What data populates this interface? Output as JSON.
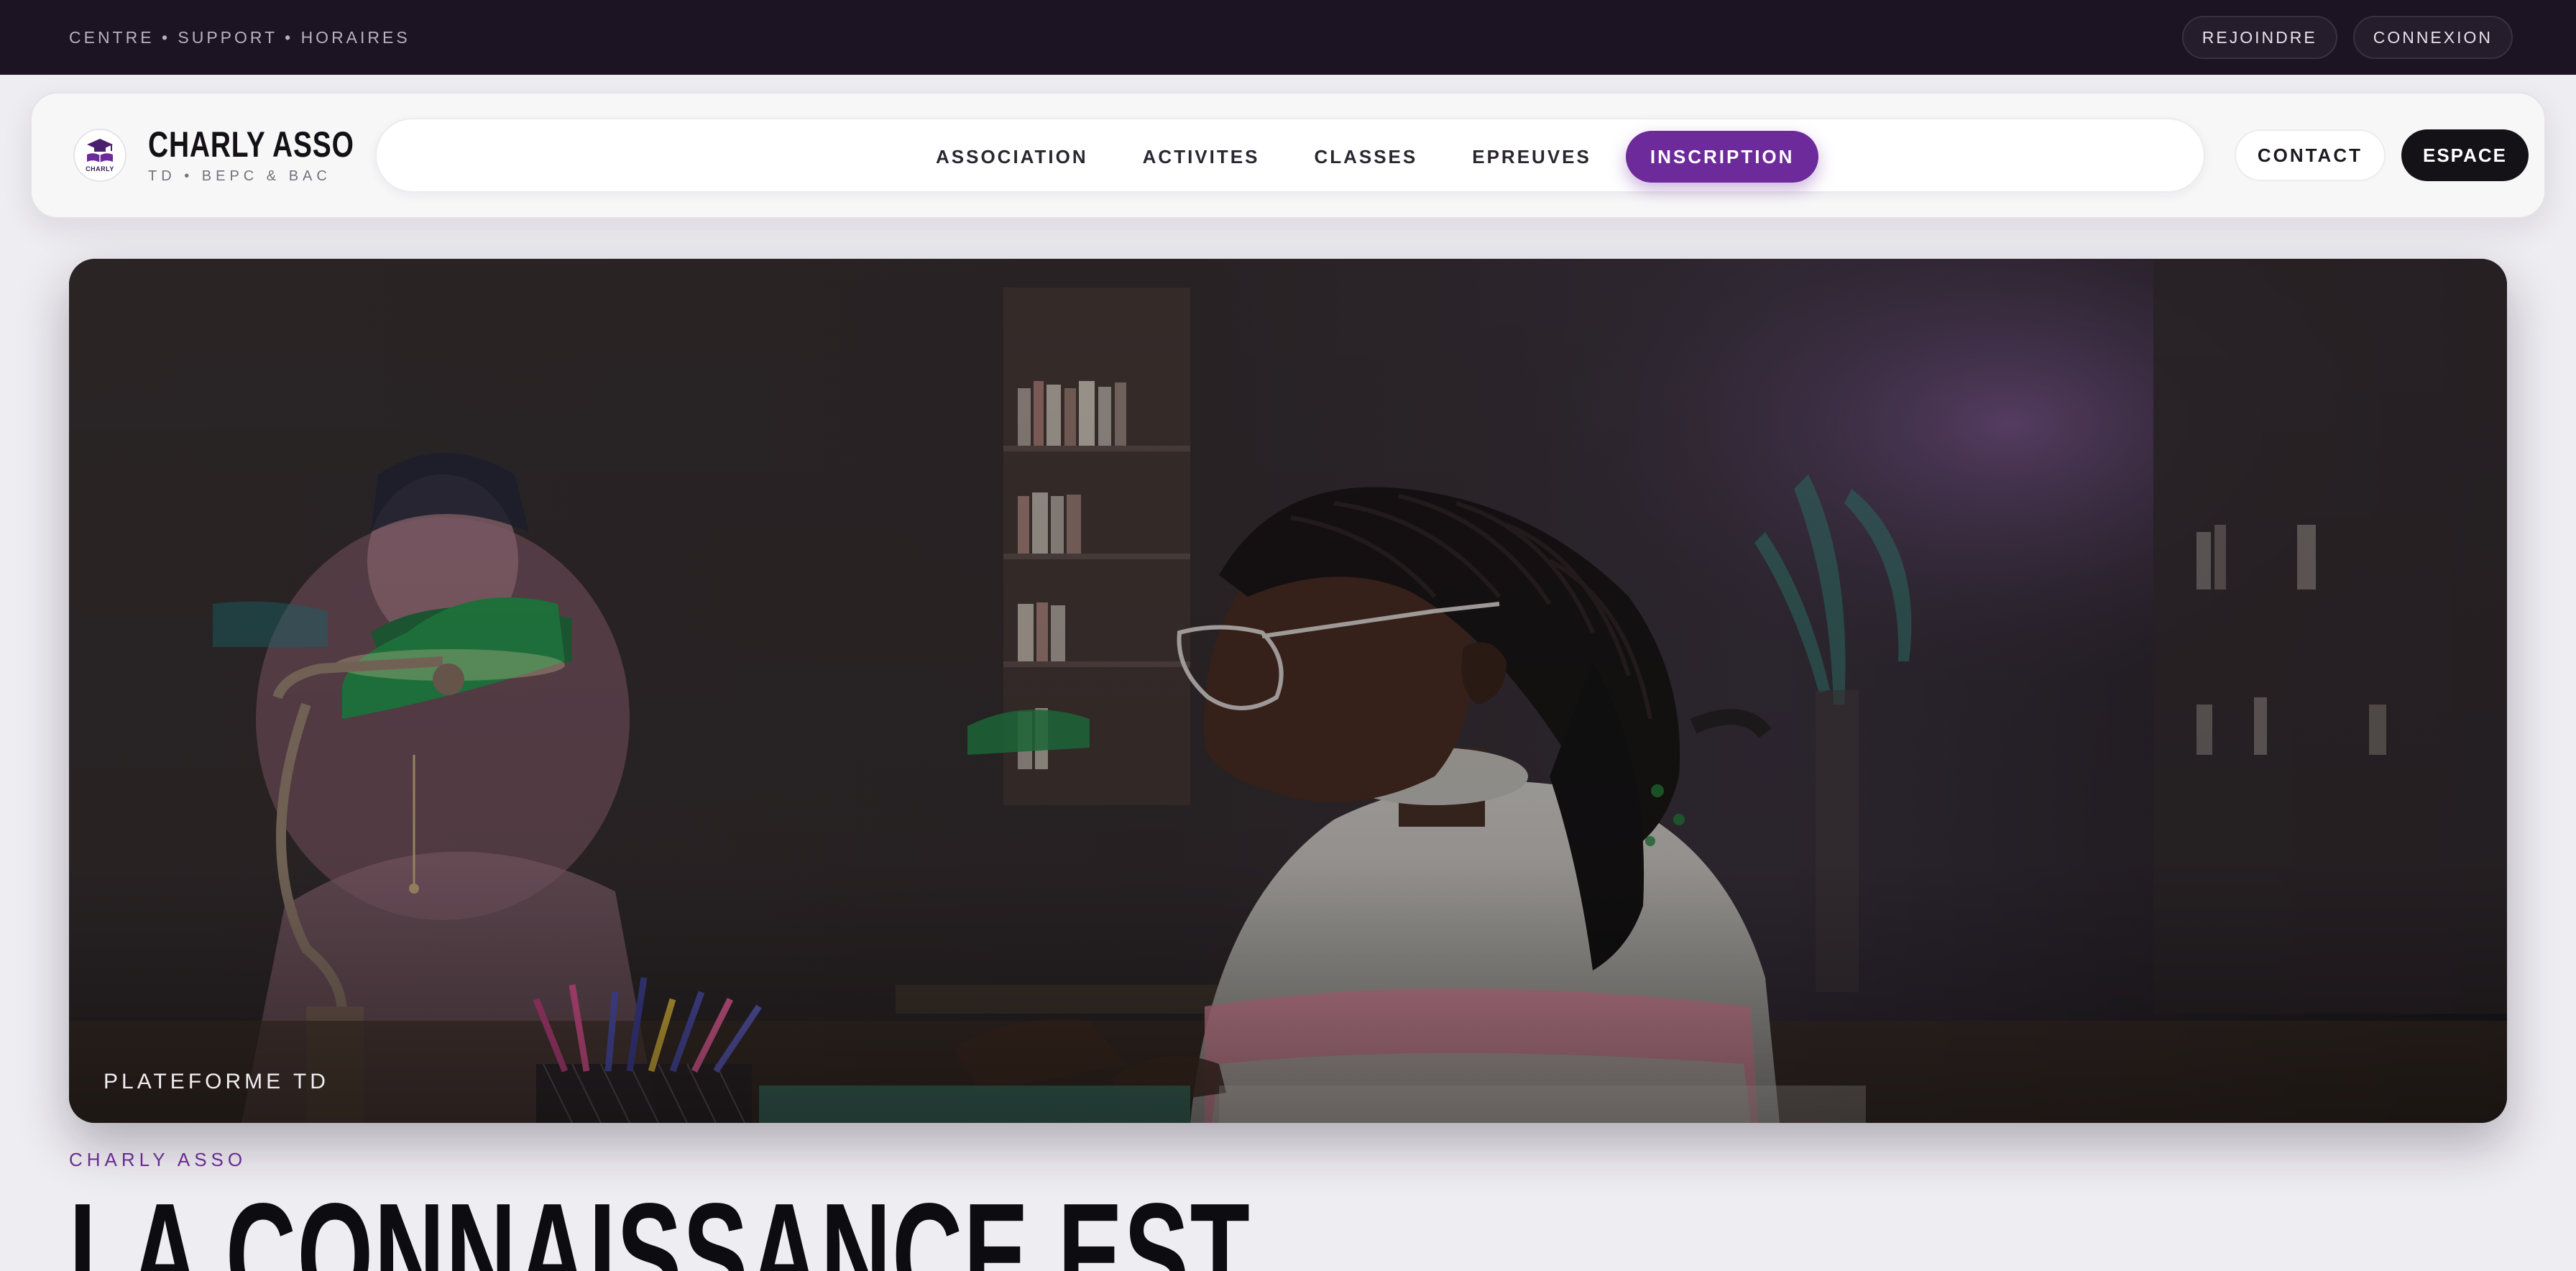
{
  "topbar": {
    "links": "CENTRE • SUPPORT • HORAIRES",
    "join_label": "REJOINDRE",
    "login_label": "CONNEXION"
  },
  "brand": {
    "logo_text": "CHARLY",
    "name": "CHARLY ASSO",
    "tagline": "TD • BEPC & BAC"
  },
  "nav": {
    "items": [
      {
        "label": "ASSOCIATION",
        "active": false
      },
      {
        "label": "ACTIVITES",
        "active": false
      },
      {
        "label": "CLASSES",
        "active": false
      },
      {
        "label": "EPREUVES",
        "active": false
      },
      {
        "label": "INSCRIPTION",
        "active": true
      }
    ],
    "contact_label": "CONTACT",
    "space_label": "ESPACE"
  },
  "hero": {
    "caption": "PLATEFORME TD"
  },
  "intro": {
    "eyebrow": "CHARLY ASSO",
    "headline": "LA CONNAISSANCE EST"
  },
  "colors": {
    "accent": "#6d2a9a",
    "topbar_bg": "#1c1422",
    "page_bg": "#eeedf1",
    "dark_button": "#141216"
  },
  "icons": {
    "logo": "graduation-cap-book-icon"
  }
}
